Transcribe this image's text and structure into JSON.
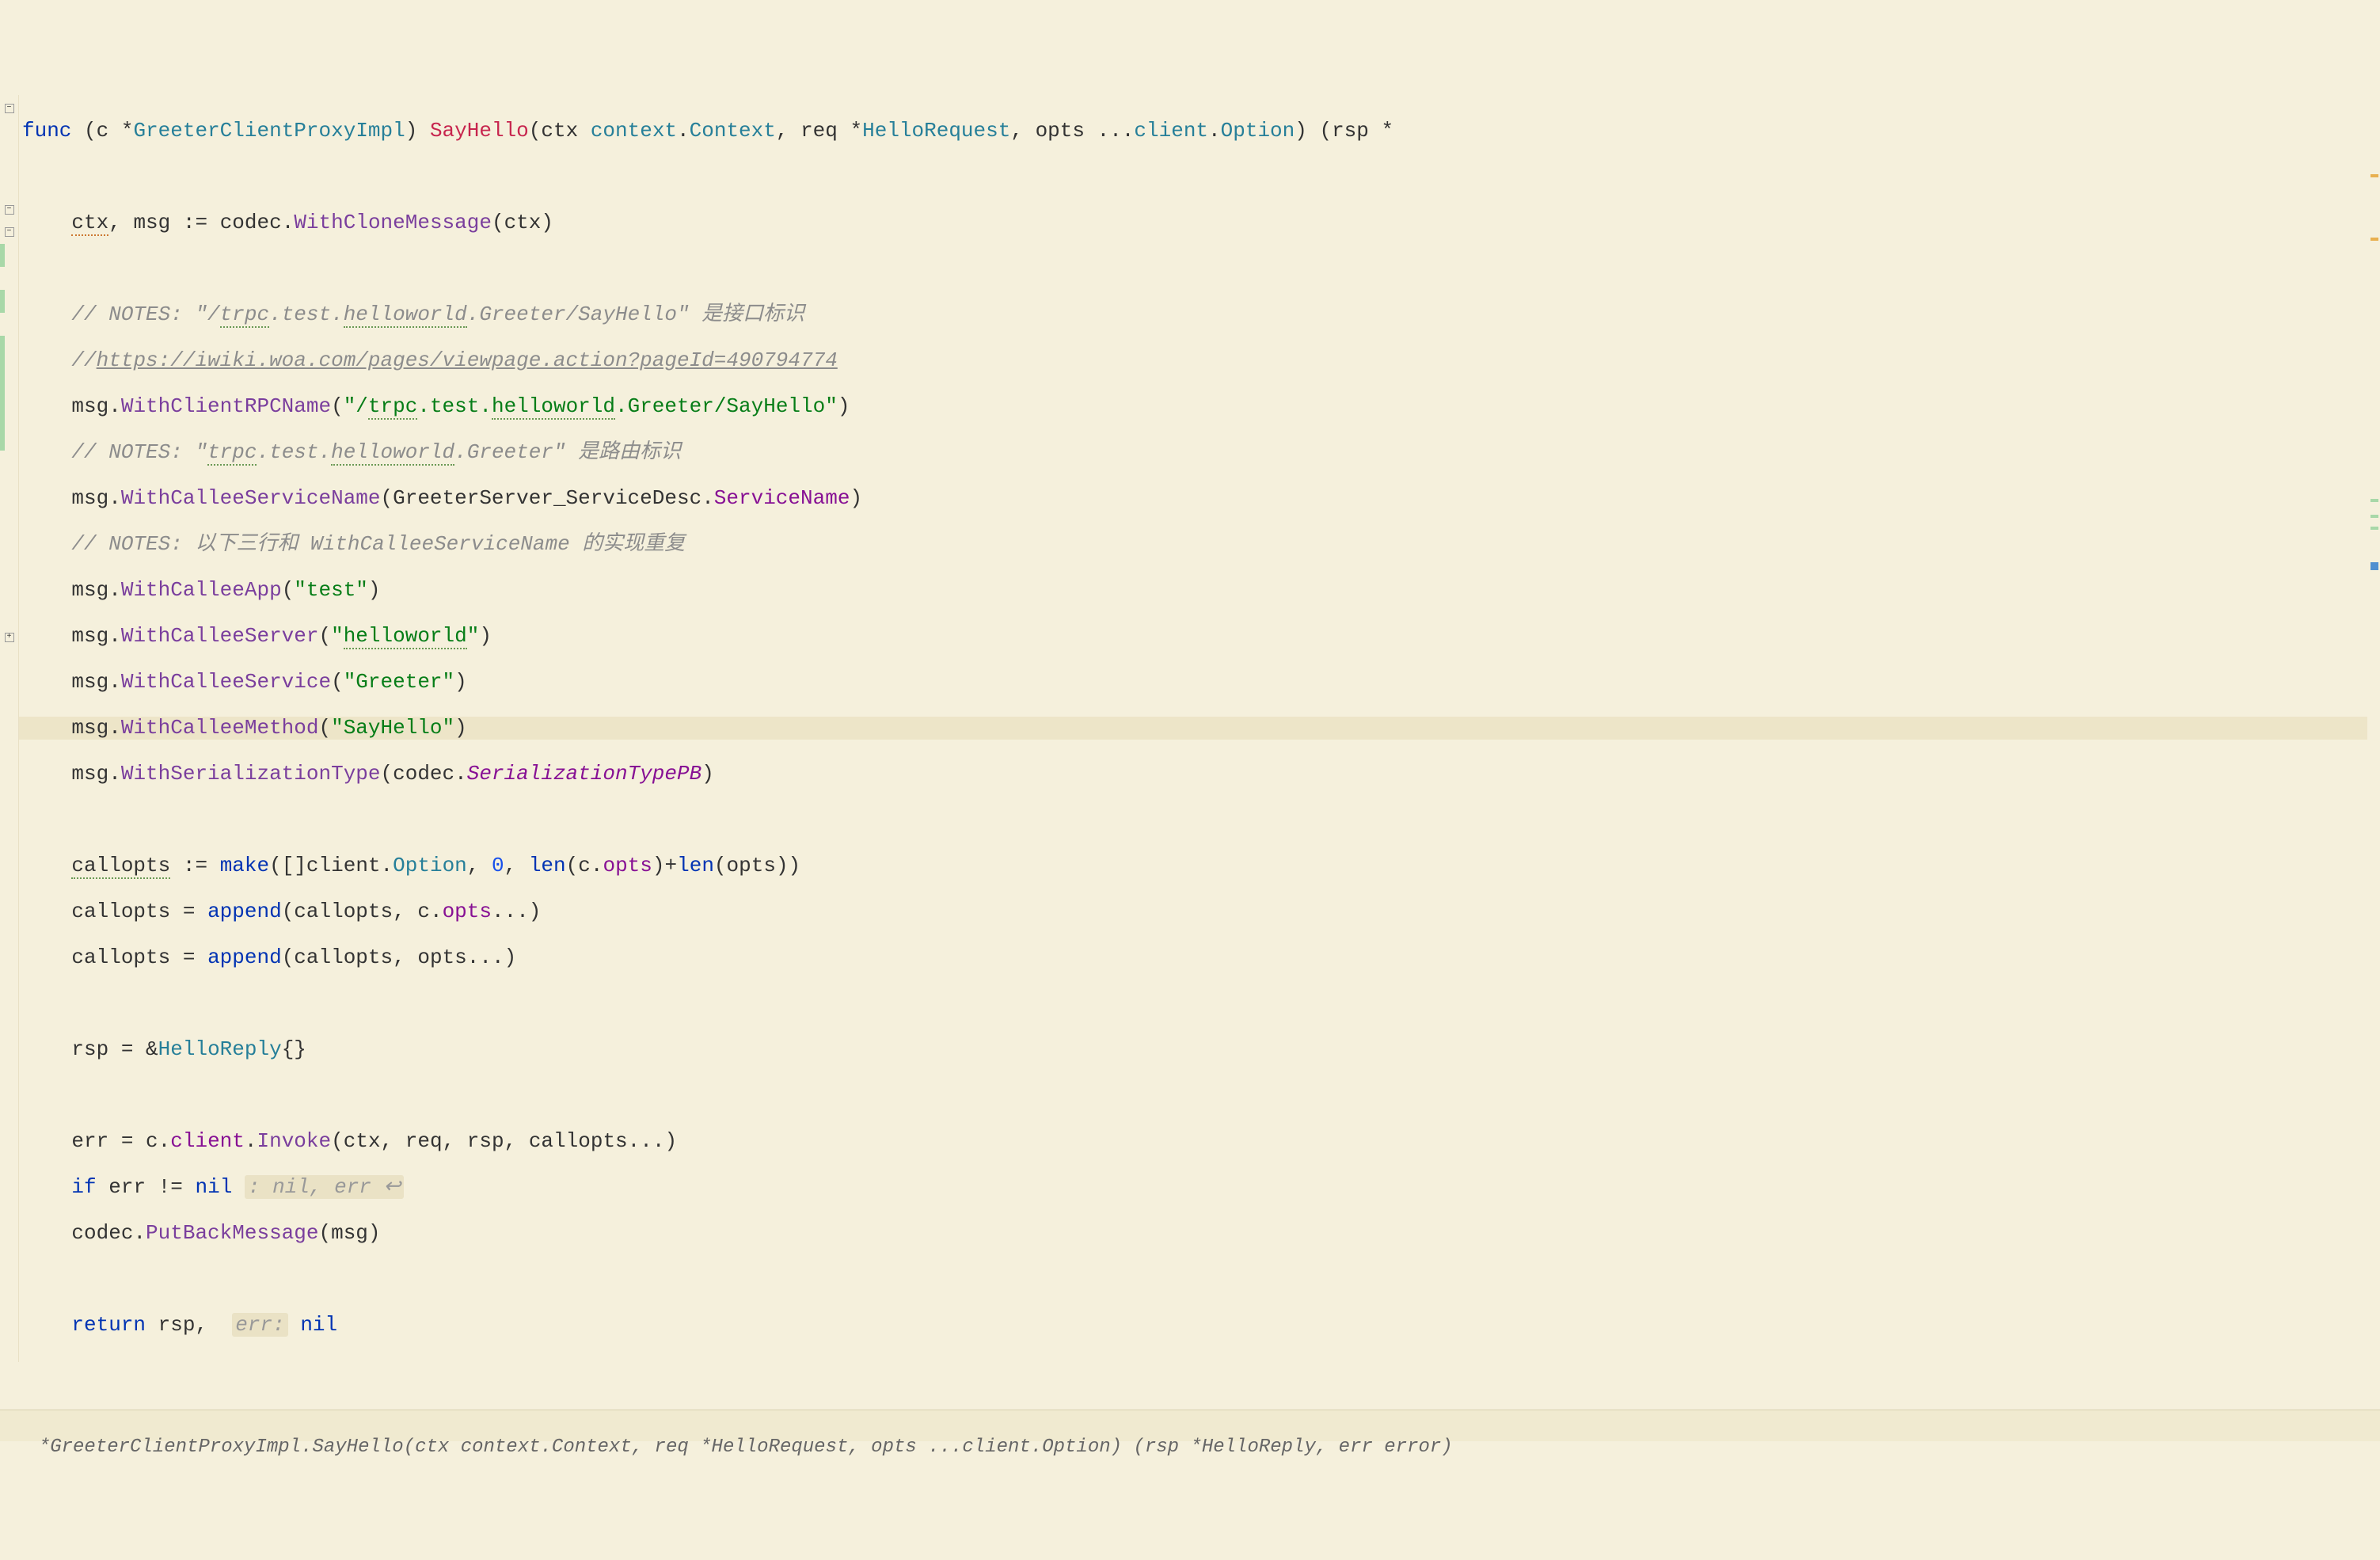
{
  "lines": {
    "l1": {
      "func": "func",
      "receiver_c": "c",
      "star": "*",
      "receiver_type": "GreeterClientProxyImpl",
      "method": "SayHello",
      "ctx": "ctx",
      "ctx_type": "context",
      "ctx_type2": "Context",
      "req": "req",
      "req_type": "HelloRequest",
      "opts": "opts",
      "client": "client",
      "option": "Option",
      "rsp": "rsp"
    },
    "l3": {
      "ctx": "ctx",
      "msg": "msg",
      "assign": ":=",
      "codec": "codec",
      "method": "WithCloneMessage",
      "arg": "ctx"
    },
    "l5": {
      "prefix": "// NOTES: \"/",
      "trpc": "trpc",
      "mid1": ".test.",
      "hello": "helloworld",
      "suffix": ".Greeter/SayHello\" 是接口标识"
    },
    "l6": {
      "prefix": "//",
      "url": "https://iwiki.woa.com/pages/viewpage.action?pageId=490794774"
    },
    "l7": {
      "msg": "msg",
      "method": "WithClientRPCName",
      "str_open": "\"/",
      "trpc": "trpc",
      "mid1": ".test.",
      "hello": "helloworld",
      "str_close": ".Greeter/SayHello\""
    },
    "l8": {
      "prefix": "// NOTES: \"",
      "trpc": "trpc",
      "mid1": ".test.",
      "hello": "helloworld",
      "suffix": ".Greeter\" 是路由标识"
    },
    "l9": {
      "msg": "msg",
      "method": "WithCalleeServiceName",
      "arg1": "GreeterServer_ServiceDesc",
      "field": "ServiceName"
    },
    "l10": {
      "text": "// NOTES: 以下三行和 WithCalleeServiceName 的实现重复"
    },
    "l11": {
      "msg": "msg",
      "method": "WithCalleeApp",
      "str": "\"test\""
    },
    "l12": {
      "msg": "msg",
      "method": "WithCalleeServer",
      "str_open": "\"",
      "hello": "helloworld",
      "str_close": "\""
    },
    "l13": {
      "msg": "msg",
      "method": "WithCalleeService",
      "str": "\"Greeter\""
    },
    "l14": {
      "msg": "msg",
      "method": "WithCalleeMethod",
      "str": "\"SayHello\""
    },
    "l15": {
      "msg": "msg",
      "method": "WithSerializationType",
      "codec": "codec",
      "field": "SerializationTypePB"
    },
    "l17": {
      "var": "callopts",
      "assign": ":=",
      "make": "make",
      "client": "client",
      "option": "Option",
      "zero": "0",
      "len": "len",
      "c": "c",
      "opts": "opts",
      "opts2": "opts"
    },
    "l18": {
      "var": "callopts",
      "append": "append",
      "arg1": "callopts",
      "c": "c",
      "opts": "opts"
    },
    "l19": {
      "var": "callopts",
      "append": "append",
      "arg1": "callopts",
      "opts": "opts"
    },
    "l21": {
      "rsp": "rsp",
      "type": "HelloReply"
    },
    "l23": {
      "err": "err",
      "c": "c",
      "client": "client",
      "invoke": "Invoke",
      "ctx": "ctx",
      "req": "req",
      "rsp": "rsp",
      "callopts": "callopts"
    },
    "l24": {
      "if": "if",
      "err": "err",
      "nil": "nil",
      "hint": ": nil, err ↩"
    },
    "l25": {
      "codec": "codec",
      "method": "PutBackMessage",
      "msg": "msg"
    },
    "l27": {
      "return": "return",
      "rsp": "rsp",
      "err_label": "err:",
      "nil": "nil"
    }
  },
  "breadcrumb": "*GreeterClientProxyImpl.SayHello(ctx context.Context, req *HelloRequest, opts ...client.Option) (rsp *HelloReply, err error)"
}
